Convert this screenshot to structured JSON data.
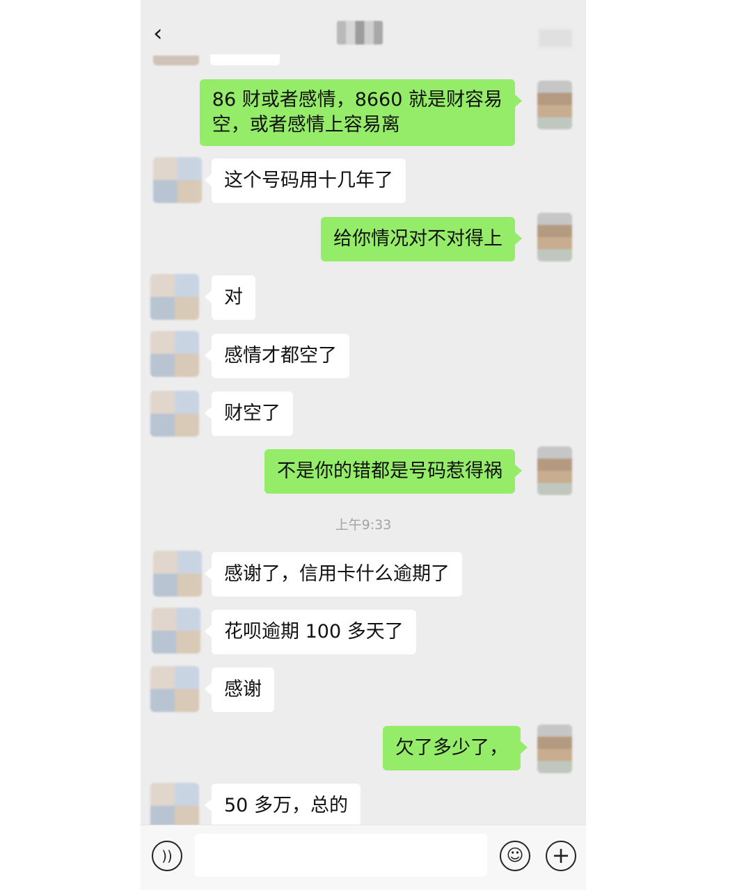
{
  "header": {
    "title": "■■",
    "back_icon": "‹"
  },
  "messages": [
    {
      "side": "out",
      "lines": [
        "86 财或者感情，8660 就是财容易",
        "空，或者感情上容易离"
      ]
    },
    {
      "side": "in",
      "text": "这个号码用十几年了"
    },
    {
      "side": "out",
      "text": "给你情况对不对得上"
    },
    {
      "side": "in",
      "text": "对"
    },
    {
      "side": "in",
      "text": "感情才都空了"
    },
    {
      "side": "in",
      "text": "财空了"
    },
    {
      "side": "out",
      "text": "不是你的错都是号码惹得祸"
    },
    {
      "side": "in",
      "text": "感谢了，信用卡什么逾期了"
    },
    {
      "side": "in",
      "text": "花呗逾期 100 多天了"
    },
    {
      "side": "in",
      "text": "感谢"
    },
    {
      "side": "out",
      "text": "欠了多少了，"
    },
    {
      "side": "in",
      "text": "50 多万，总的"
    }
  ],
  "timestamp": "上午9:33",
  "bottom_bar": {
    "voice_icon": "))",
    "emoji_icon": "☺",
    "plus_icon": "+"
  },
  "colors": {
    "background": "#ededed",
    "outgoing_bubble": "#95ec69",
    "incoming_bubble": "#ffffff"
  }
}
